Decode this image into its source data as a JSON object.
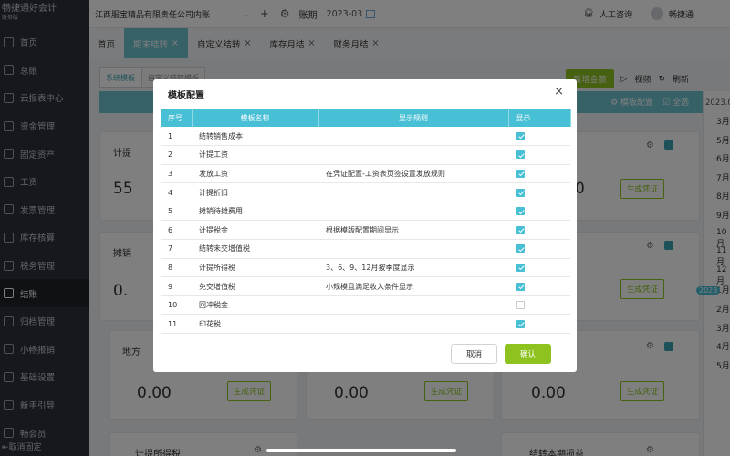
{
  "app": {
    "logo": "畅捷通好会计",
    "logo_sub": "财务版"
  },
  "sidebar": {
    "items": [
      {
        "label": "首页",
        "icon": "home-icon"
      },
      {
        "label": "总账",
        "icon": "ledger-icon"
      },
      {
        "label": "云报表中心",
        "icon": "report-icon"
      },
      {
        "label": "资金管理",
        "icon": "fund-icon"
      },
      {
        "label": "固定资产",
        "icon": "asset-icon"
      },
      {
        "label": "工资",
        "icon": "salary-icon"
      },
      {
        "label": "发票管理",
        "icon": "invoice-icon"
      },
      {
        "label": "库存核算",
        "icon": "inventory-icon"
      },
      {
        "label": "税务管理",
        "icon": "tax-icon"
      },
      {
        "label": "结账",
        "icon": "close-books-icon"
      },
      {
        "label": "归档管理",
        "icon": "archive-icon"
      },
      {
        "label": "小畅报销",
        "icon": "expense-icon"
      },
      {
        "label": "基础设置",
        "icon": "settings-icon"
      },
      {
        "label": "新手引导",
        "icon": "guide-icon"
      },
      {
        "label": "畅会员",
        "icon": "member-icon"
      }
    ],
    "collapse_label": "取消固定"
  },
  "topbar": {
    "company": "江西服宝精品有限责任公司内账",
    "period_label": "账期",
    "period": "2023-03",
    "help_label": "人工咨询",
    "user": "畅捷通"
  },
  "tabs": [
    {
      "label": "首页",
      "closable": false,
      "active": false
    },
    {
      "label": "期末结转",
      "closable": true,
      "active": true
    },
    {
      "label": "自定义结转",
      "closable": true,
      "active": false
    },
    {
      "label": "库存月结",
      "closable": true,
      "active": false
    },
    {
      "label": "财务月结",
      "closable": true,
      "active": false
    }
  ],
  "main": {
    "subtabs": [
      "系统模板",
      "自定义结转模板"
    ],
    "green_button": "新增金额",
    "video_label": "视频",
    "refresh_label": "刷新",
    "template_config": "模板配置",
    "select_all": "全选",
    "gen_voucher": "生成凭证",
    "cards": [
      {
        "title": "计提",
        "value": "55"
      },
      {
        "title": "",
        "value": "0"
      },
      {
        "title": "摊销",
        "value": "0."
      },
      {
        "title": "地方",
        "value": "0.00"
      },
      {
        "title": "",
        "value": "0.00"
      },
      {
        "title": "",
        "value": "0.00"
      },
      {
        "title": "计提所得税",
        "value": ""
      },
      {
        "title": "结转本期损益",
        "value": ""
      }
    ]
  },
  "datepanel": {
    "year": "2023.0",
    "months": [
      "3月",
      "5月",
      "6月",
      "7月",
      "8月",
      "9月",
      "10月",
      "11月",
      "12月",
      "1月",
      "2月",
      "3月",
      "4月",
      "5月"
    ],
    "year_badge": "2023"
  },
  "modal": {
    "title": "模板配置",
    "columns": [
      "序号",
      "模板名称",
      "显示规则",
      "显示"
    ],
    "rows": [
      {
        "no": "1",
        "name": "结转销售成本",
        "rule": "",
        "show": true
      },
      {
        "no": "2",
        "name": "计提工资",
        "rule": "",
        "show": true
      },
      {
        "no": "3",
        "name": "发放工资",
        "rule": "在凭证配置-工资表页签设置发放规则",
        "show": true
      },
      {
        "no": "4",
        "name": "计提折旧",
        "rule": "",
        "show": true
      },
      {
        "no": "5",
        "name": "摊销待摊费用",
        "rule": "",
        "show": true
      },
      {
        "no": "6",
        "name": "计提税金",
        "rule": "根据模版配置期间显示",
        "show": true
      },
      {
        "no": "7",
        "name": "结转未交增值税",
        "rule": "",
        "show": true
      },
      {
        "no": "8",
        "name": "计提所得税",
        "rule": "3、6、9、12月按季度显示",
        "show": true
      },
      {
        "no": "9",
        "name": "免交增值税",
        "rule": "小规模且满足收入条件显示",
        "show": true
      },
      {
        "no": "10",
        "name": "回冲税金",
        "rule": "",
        "show": false
      },
      {
        "no": "11",
        "name": "印花税",
        "rule": "",
        "show": true
      }
    ],
    "cancel": "取消",
    "confirm": "确认"
  }
}
